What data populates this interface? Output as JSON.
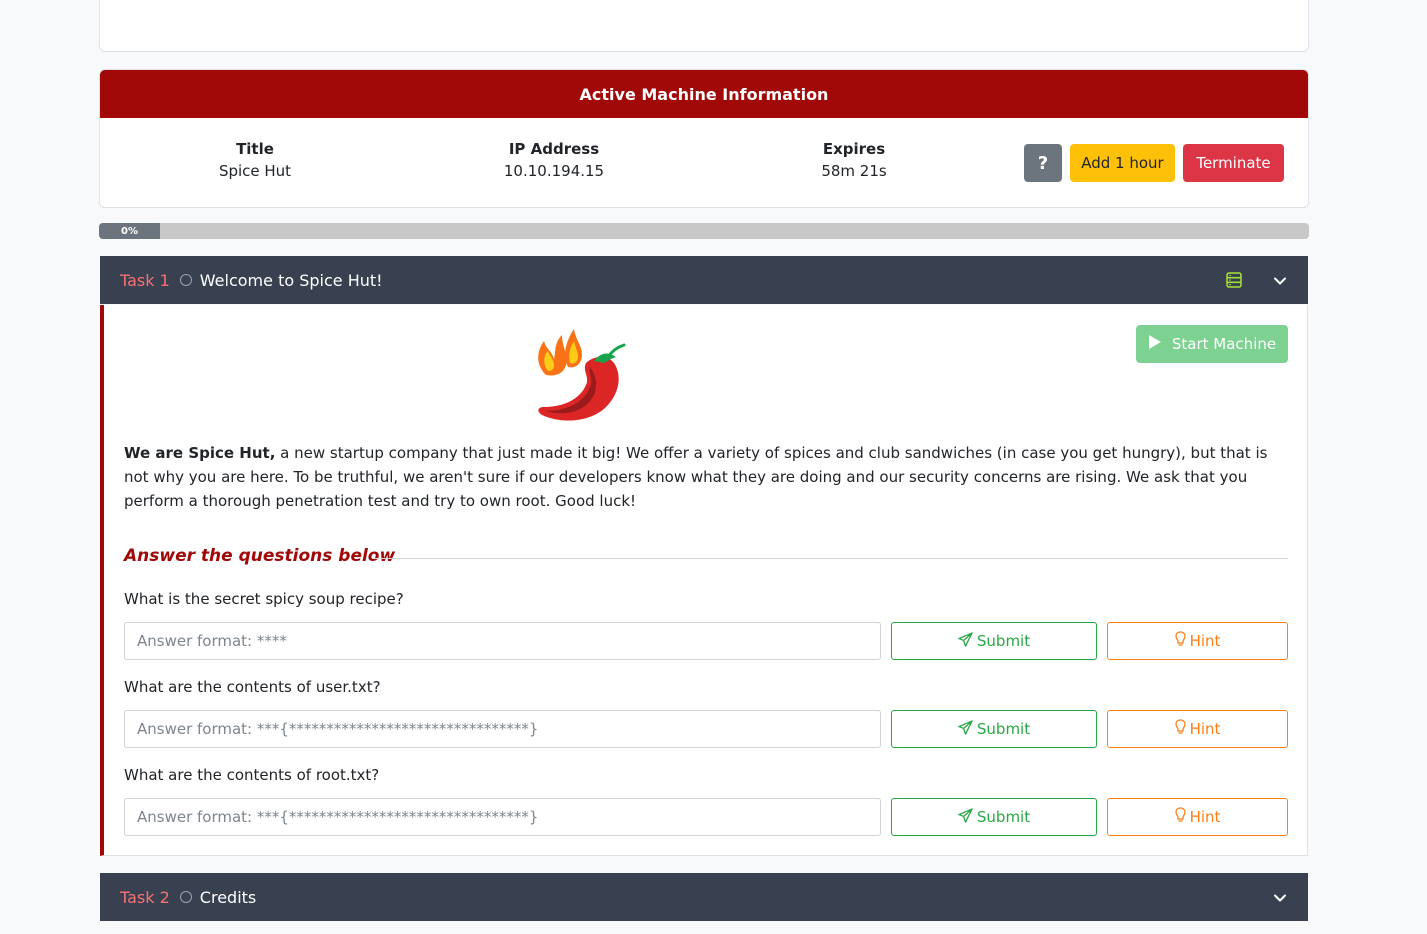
{
  "machine": {
    "header": "Active Machine Information",
    "title_label": "Title",
    "title_value": "Spice Hut",
    "ip_label": "IP Address",
    "ip_value": "10.10.194.15",
    "expires_label": "Expires",
    "expires_value": "58m 21s",
    "help_label": "?",
    "add_hour_label": "Add 1 hour",
    "terminate_label": "Terminate"
  },
  "progress": {
    "label": "0%",
    "value_percent": 0
  },
  "task1": {
    "number": "Task 1",
    "title": "Welcome to Spice Hut!",
    "start_machine_label": "Start Machine",
    "desc_bold": "We are Spice Hut,",
    "desc_rest": " a new startup company that just made it big! We offer a variety of spices and club sandwiches (in case you get hungry), but that is not why you are here. To be truthful, we aren't sure if our developers know what they are doing and our security concerns are rising. We ask that you perform a thorough penetration test and try to own root. Good luck!",
    "answers_heading": "Answer the questions below",
    "questions": [
      {
        "text": "What is the secret spicy soup recipe?",
        "placeholder": "Answer format: ****",
        "submit": "Submit",
        "hint": "Hint"
      },
      {
        "text": "What are the contents of user.txt?",
        "placeholder": "Answer format: ***{********************************}",
        "submit": "Submit",
        "hint": "Hint"
      },
      {
        "text": "What are the contents of root.txt?",
        "placeholder": "Answer format: ***{********************************}",
        "submit": "Submit",
        "hint": "Hint"
      }
    ]
  },
  "task2": {
    "number": "Task 2",
    "title": "Credits"
  },
  "colors": {
    "brand_red": "#a10808",
    "task_header": "#394150",
    "submit_green": "#28a745",
    "hint_orange": "#fd7e14"
  }
}
